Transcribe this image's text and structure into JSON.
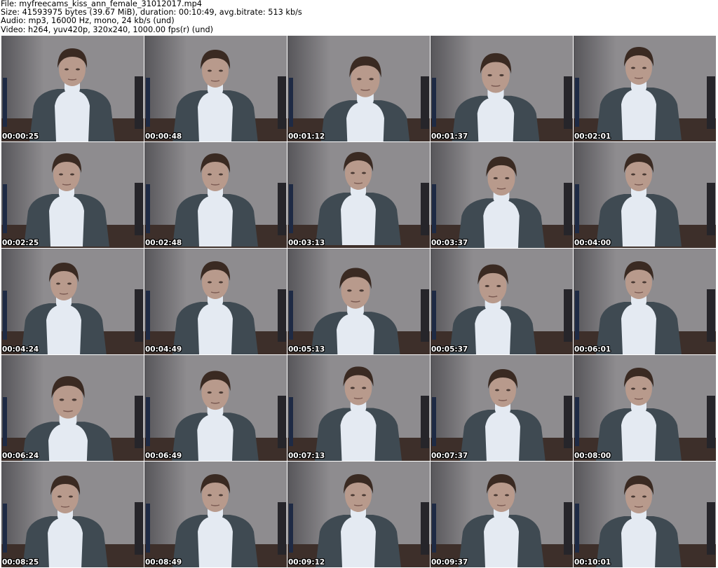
{
  "header": {
    "file_line": "File: myfreecams_kiss_ann_female_31012017.mp4",
    "size_line": "Size: 41593975 bytes (39.67 MiB), duration: 00:10:49, avg.bitrate: 513 kb/s",
    "audio_line": "Audio: mp3, 16000 Hz, mono, 24 kb/s (und)",
    "video_line": "Video: h264, yuv420p, 320x240, 1000.00 fps(r) (und)"
  },
  "colors": {
    "wall": "#8e8c8f",
    "wall_shadow": "#57565a",
    "floor": "#3d2f2a",
    "cardigan": "#3f4a52",
    "turtleneck": "#e4eaf2",
    "skin": "#b89a8c",
    "hair": "#3a2a22",
    "timestamp_text": "#ffffff"
  },
  "frames": [
    {
      "timestamp": "00:00:25"
    },
    {
      "timestamp": "00:00:48"
    },
    {
      "timestamp": "00:01:12"
    },
    {
      "timestamp": "00:01:37"
    },
    {
      "timestamp": "00:02:01"
    },
    {
      "timestamp": "00:02:25"
    },
    {
      "timestamp": "00:02:48"
    },
    {
      "timestamp": "00:03:13"
    },
    {
      "timestamp": "00:03:37"
    },
    {
      "timestamp": "00:04:00"
    },
    {
      "timestamp": "00:04:24"
    },
    {
      "timestamp": "00:04:49"
    },
    {
      "timestamp": "00:05:13"
    },
    {
      "timestamp": "00:05:37"
    },
    {
      "timestamp": "00:06:01"
    },
    {
      "timestamp": "00:06:24"
    },
    {
      "timestamp": "00:06:49"
    },
    {
      "timestamp": "00:07:13"
    },
    {
      "timestamp": "00:07:37"
    },
    {
      "timestamp": "00:08:00"
    },
    {
      "timestamp": "00:08:25"
    },
    {
      "timestamp": "00:08:49"
    },
    {
      "timestamp": "00:09:12"
    },
    {
      "timestamp": "00:09:37"
    },
    {
      "timestamp": "00:10:01"
    }
  ]
}
